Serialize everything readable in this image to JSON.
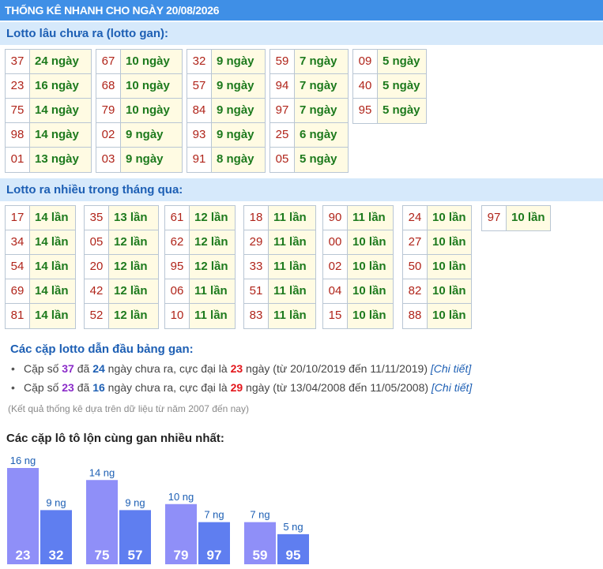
{
  "header": {
    "title": "THỐNG KÊ NHANH CHO NGÀY 20/08/2026"
  },
  "gan": {
    "title": "Lotto lâu chưa ra (lotto gan):",
    "columns": [
      [
        {
          "n": "37",
          "v": "24 ngày"
        },
        {
          "n": "23",
          "v": "16 ngày"
        },
        {
          "n": "75",
          "v": "14 ngày"
        },
        {
          "n": "98",
          "v": "14 ngày"
        },
        {
          "n": "01",
          "v": "13 ngày"
        }
      ],
      [
        {
          "n": "67",
          "v": "10 ngày"
        },
        {
          "n": "68",
          "v": "10 ngày"
        },
        {
          "n": "79",
          "v": "10 ngày"
        },
        {
          "n": "02",
          "v": "9 ngày"
        },
        {
          "n": "03",
          "v": "9 ngày"
        }
      ],
      [
        {
          "n": "32",
          "v": "9 ngày"
        },
        {
          "n": "57",
          "v": "9 ngày"
        },
        {
          "n": "84",
          "v": "9 ngày"
        },
        {
          "n": "93",
          "v": "9 ngày"
        },
        {
          "n": "91",
          "v": "8 ngày"
        }
      ],
      [
        {
          "n": "59",
          "v": "7 ngày"
        },
        {
          "n": "94",
          "v": "7 ngày"
        },
        {
          "n": "97",
          "v": "7 ngày"
        },
        {
          "n": "25",
          "v": "6 ngày"
        },
        {
          "n": "05",
          "v": "5 ngày"
        }
      ],
      [
        {
          "n": "09",
          "v": "5 ngày"
        },
        {
          "n": "40",
          "v": "5 ngày"
        },
        {
          "n": "95",
          "v": "5 ngày"
        }
      ]
    ]
  },
  "frequent": {
    "title": "Lotto ra nhiều trong tháng qua:",
    "columns": [
      [
        {
          "n": "17",
          "v": "14 lần"
        },
        {
          "n": "34",
          "v": "14 lần"
        },
        {
          "n": "54",
          "v": "14 lần"
        },
        {
          "n": "69",
          "v": "14 lần"
        },
        {
          "n": "81",
          "v": "14 lần"
        }
      ],
      [
        {
          "n": "35",
          "v": "13 lần"
        },
        {
          "n": "05",
          "v": "12 lần"
        },
        {
          "n": "20",
          "v": "12 lần"
        },
        {
          "n": "42",
          "v": "12 lần"
        },
        {
          "n": "52",
          "v": "12 lần"
        }
      ],
      [
        {
          "n": "61",
          "v": "12 lần"
        },
        {
          "n": "62",
          "v": "12 lần"
        },
        {
          "n": "95",
          "v": "12 lần"
        },
        {
          "n": "06",
          "v": "11 lần"
        },
        {
          "n": "10",
          "v": "11 lần"
        }
      ],
      [
        {
          "n": "18",
          "v": "11 lần"
        },
        {
          "n": "29",
          "v": "11 lần"
        },
        {
          "n": "33",
          "v": "11 lần"
        },
        {
          "n": "51",
          "v": "11 lần"
        },
        {
          "n": "83",
          "v": "11 lần"
        }
      ],
      [
        {
          "n": "90",
          "v": "11 lần"
        },
        {
          "n": "00",
          "v": "10 lần"
        },
        {
          "n": "02",
          "v": "10 lần"
        },
        {
          "n": "04",
          "v": "10 lần"
        },
        {
          "n": "15",
          "v": "10 lần"
        }
      ],
      [
        {
          "n": "24",
          "v": "10 lần"
        },
        {
          "n": "27",
          "v": "10 lần"
        },
        {
          "n": "50",
          "v": "10 lần"
        },
        {
          "n": "82",
          "v": "10 lần"
        },
        {
          "n": "88",
          "v": "10 lần"
        }
      ],
      [
        {
          "n": "97",
          "v": "10 lần"
        }
      ]
    ]
  },
  "pairs": {
    "title": "Các cặp lotto dẫn đầu bảng gan:",
    "items": [
      {
        "bullet": "•",
        "t1": "Cặp số ",
        "num": "37",
        "t2": " đã ",
        "days": "24",
        "t3": " ngày chưa ra, cực đại là ",
        "max": "23",
        "t4": " ngày (từ 20/10/2019 đến 11/11/2019) ",
        "link": "[Chi tiết]"
      },
      {
        "bullet": "•",
        "t1": "Cặp số ",
        "num": "23",
        "t2": " đã ",
        "days": "16",
        "t3": " ngày chưa ra, cực đại là ",
        "max": "29",
        "t4": " ngày (từ 13/04/2008 đến 11/05/2008) ",
        "link": "[Chi tiết]"
      }
    ],
    "note": "(Kết quả thống kê dựa trên dữ liệu từ năm 2007 đến nay)"
  },
  "chart_title": "Các cặp lô tô lộn cùng gan nhiều nhất:",
  "chart_data": {
    "type": "bar",
    "groups": [
      {
        "bars": [
          {
            "label": "23",
            "value": 16,
            "text": "16 ng"
          },
          {
            "label": "32",
            "value": 9,
            "text": "9 ng"
          }
        ]
      },
      {
        "bars": [
          {
            "label": "75",
            "value": 14,
            "text": "14 ng"
          },
          {
            "label": "57",
            "value": 9,
            "text": "9 ng"
          }
        ]
      },
      {
        "bars": [
          {
            "label": "79",
            "value": 10,
            "text": "10 ng"
          },
          {
            "label": "97",
            "value": 7,
            "text": "7 ng"
          }
        ]
      },
      {
        "bars": [
          {
            "label": "59",
            "value": 7,
            "text": "7 ng"
          },
          {
            "label": "95",
            "value": 5,
            "text": "5 ng"
          }
        ]
      }
    ],
    "colors": {
      "first": "#8f8ff8",
      "second": "#5f7ef0",
      "value_text": "#1d5fb4",
      "label_text": "#ffffff"
    },
    "ylim": [
      0,
      16
    ]
  }
}
